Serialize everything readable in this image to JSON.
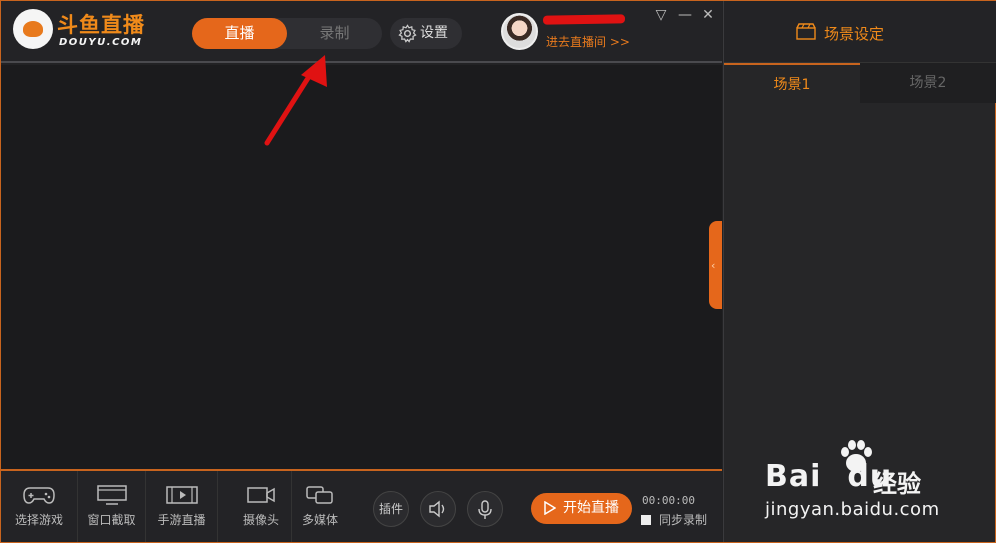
{
  "brand": {
    "name": "斗鱼直播",
    "subtitle": "DOUYU.COM"
  },
  "mode": {
    "live_label": "直播",
    "record_label": "录制"
  },
  "settings_label": "设置",
  "user": {
    "enter_room": "进去直播间 >>"
  },
  "window_controls": {
    "menu": "▽",
    "minimize": "—",
    "close": "✕"
  },
  "toolbar": {
    "items": [
      {
        "label": "选择游戏",
        "icon": "gamepad-icon"
      },
      {
        "label": "窗口截取",
        "icon": "monitor-icon"
      },
      {
        "label": "手游直播",
        "icon": "mobile-play-icon"
      },
      {
        "label": "摄像头",
        "icon": "camera-icon"
      },
      {
        "label": "多媒体",
        "icon": "media-icon"
      }
    ],
    "plugin_label": "插件",
    "start_label": "开始直播",
    "timer": "00:00:00",
    "sync_record_label": "同步录制"
  },
  "scene_panel": {
    "title": "场景设定",
    "tabs": [
      "场景1",
      "场景2"
    ]
  },
  "watermark": {
    "brand": "Bai",
    "brand_tail": "du",
    "brand_cn": "经验",
    "url": "jingyan.baidu.com"
  },
  "colors": {
    "accent": "#e5671b",
    "accent_text": "#f08a1a",
    "annotation_arrow": "#e01212"
  }
}
